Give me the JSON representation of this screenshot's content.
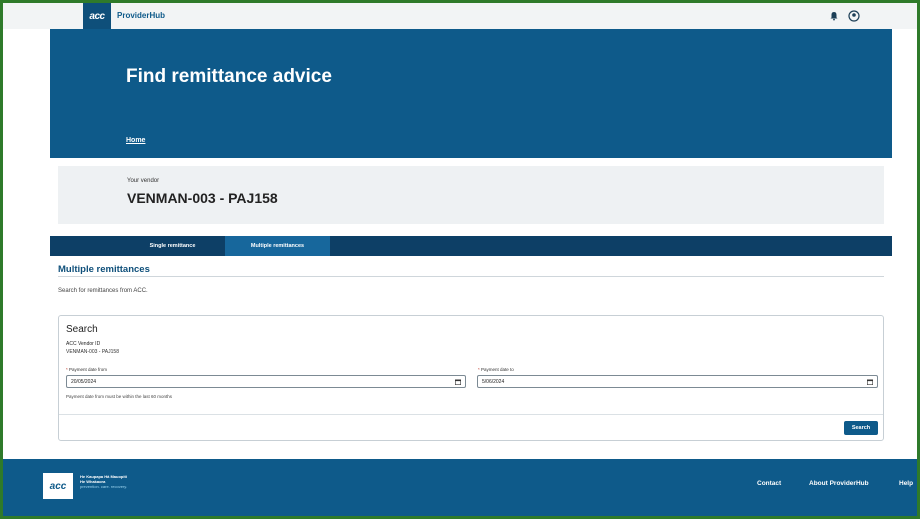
{
  "header": {
    "logo_text": "acc",
    "brand": "ProviderHub",
    "icons": [
      "bell-icon",
      "user-icon"
    ]
  },
  "hero": {
    "title": "Find remittance advice",
    "breadcrumb_home": "Home"
  },
  "vendor": {
    "label": "Your vendor",
    "value": "VENMAN-003 - PAJ158"
  },
  "tabs": [
    {
      "label": "Single remittance",
      "active": false
    },
    {
      "label": "Multiple remittances",
      "active": true
    }
  ],
  "section": {
    "title": "Multiple remittances",
    "description": "Search for remittances from ACC."
  },
  "search": {
    "title": "Search",
    "vendor_id_label": "ACC Vendor ID",
    "vendor_id_value": "VENMAN-003 - PAJ158",
    "from_label": "Payment date from",
    "from_value": "20/05/2024",
    "to_label": "Payment date to",
    "to_value": "5/06/2024",
    "hint": "Payment date from must be within the last 60 months",
    "button": "Search"
  },
  "footer": {
    "logo_text": "acc",
    "tagline_1": "He Kaupapa Hā Mauopiti",
    "tagline_2": "He Whakaora",
    "tagline_3": "prevention. care. recovery.",
    "links": [
      "Contact",
      "About ProviderHub",
      "Help"
    ]
  },
  "colors": {
    "brand_blue": "#0e5a8a",
    "tab_bar": "#0d3f66",
    "tab_active": "#17679c",
    "frame_green": "#2f7a2a"
  }
}
